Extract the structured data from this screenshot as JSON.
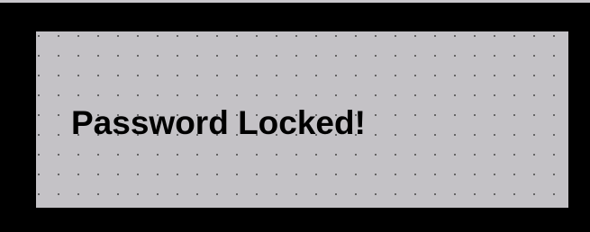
{
  "dialog": {
    "message": "Password Locked!"
  },
  "colors": {
    "frame": "#000000",
    "panel": "#c4c2c6",
    "dots": "#4a4a4a",
    "text": "#000000"
  }
}
